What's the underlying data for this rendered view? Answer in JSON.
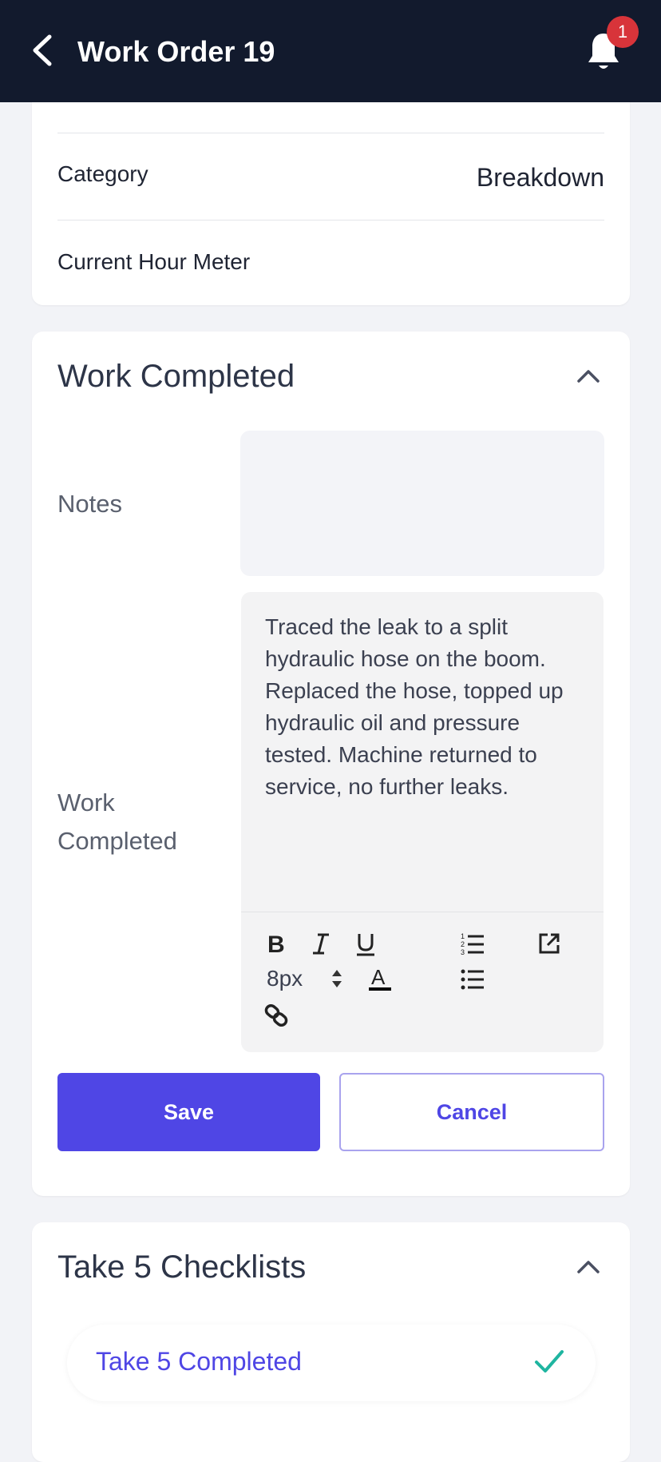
{
  "header": {
    "title": "Work Order 19",
    "notification_count": "1"
  },
  "details": {
    "category_label": "Category",
    "category_value": "Breakdown",
    "hour_meter_label": "Current Hour Meter"
  },
  "work_completed_section": {
    "title": "Work Completed",
    "notes_label": "Notes",
    "notes_value": "",
    "work_completed_label": "Work Completed",
    "work_completed_text": "Traced the leak to a split hydraulic hose on the boom. Replaced the hose, topped up hydraulic oil and pressure tested. Machine returned to service, no further leaks.",
    "font_size": "8px",
    "save_label": "Save",
    "cancel_label": "Cancel"
  },
  "take5_section": {
    "title": "Take 5 Checklists",
    "completed_label": "Take 5 Completed"
  },
  "colors": {
    "header_bg": "#121a2d",
    "accent": "#4f46e5",
    "badge": "#d8343a",
    "check": "#1fb5a0"
  }
}
